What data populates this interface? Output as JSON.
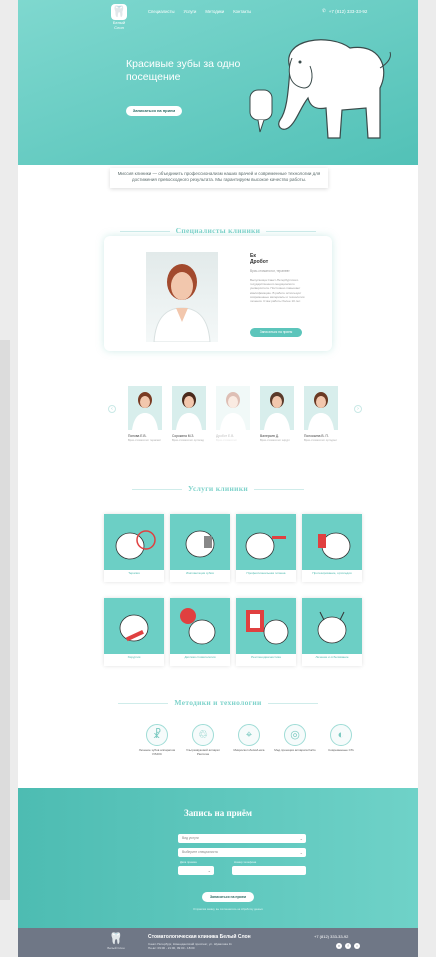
{
  "header": {
    "logo_text": "Белый Слон",
    "nav": [
      "Специалисты",
      "Услуги",
      "Методики",
      "Контакты"
    ],
    "phone": "+7 (812) 333-33-92"
  },
  "hero": {
    "title": "Красивые зубы за одно посещение",
    "cta": "Записаться на прием"
  },
  "intro": "Миссия клиники — объединить профессионализм наших врачей и современные технологии для достижения превосходного результата. Мы гарантируем высокое качество работы.",
  "specialists": {
    "title": "Специалисты клиники",
    "featured": {
      "name_line1": "Ек",
      "name_line2": "Дробот",
      "role": "Врач-стоматолог, терапевт",
      "description": "Выпускница Санкт-Петербургского государственного медицинского университета. Постоянно повышает квалификацию. В работе использует современные материалы и технологии лечения. Стаж работы более 10 лет.",
      "button": "Записаться на прием"
    },
    "carousel": [
      {
        "name": "Попова Е.В.",
        "role": "Врач-стоматолог терапевт"
      },
      {
        "name": "Сорокина М.З.",
        "role": "Врач-стоматолог ортопед"
      },
      {
        "name": "Дробот Е.В.",
        "role": "Врач-стоматолог"
      },
      {
        "name": "Валерьев Д.",
        "role": "Врач-стоматолог хирург"
      },
      {
        "name": "Полоскина В. П.",
        "role": "Врач-стоматолог ортодонт"
      }
    ]
  },
  "services": {
    "title": "Услуги клиники",
    "items": [
      "Терапия",
      "Имплантация зубов",
      "Профессиональная гигиена",
      "Протезирование, ортопедия",
      "Хирургия",
      "Детская стоматология",
      "Рентгенодиагностика",
      "Лечение и отбеливание"
    ]
  },
  "methods": {
    "title": "Методики и технологии",
    "items": [
      "Лечение зубов аппаратом VISIOC",
      "Ультразвуковой аппарат Piezonas",
      "Микроскоп Zeiss/Leica",
      "Мед.проекция аппарата KaVo",
      "Современные CTs"
    ]
  },
  "booking": {
    "title": "Запись на приём",
    "service_placeholder": "Вид услуги",
    "doctor_placeholder": "Выберите специалиста",
    "date_label": "Дата приема",
    "phone_label": "Номер телефона",
    "button": "Записаться на прием",
    "policy": "Отправляя заявку, вы соглашаетесь на обработку данных"
  },
  "footer": {
    "title": "Стоматологическая клиника Белый Слон",
    "address": "Санкт-Петербург, Комендантский проспект, ул. Шувалова 11",
    "hours": "Пн-вс: 09:00 - 21:00, 09:00 - 18:00",
    "phone": "+7 (812) 333-33-92",
    "logo_text": "Белый Слон"
  },
  "colors": {
    "accent": "#5cc5bb",
    "footer": "#6f7786"
  }
}
